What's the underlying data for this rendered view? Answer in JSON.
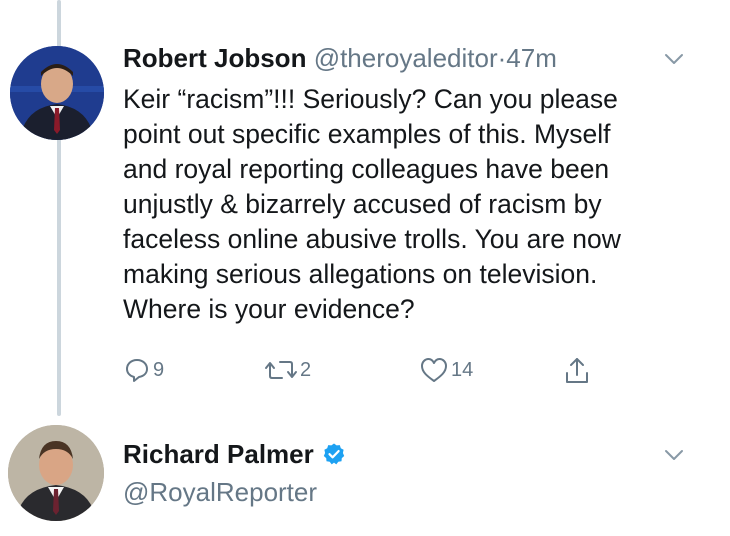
{
  "tweet1": {
    "name": "Robert Jobson",
    "handle": "@theroyaleditor",
    "separator": "·",
    "time": "47m",
    "text_lines": [
      "Keir “racism”!!! Seriously? Can you please",
      "point out specific examples of this. Myself",
      "and royal reporting colleagues have been",
      "unjustly & bizarrely accused of racism by",
      "faceless online abusive trolls. You are now",
      "making serious allegations on television.",
      "Where is your evidence?"
    ],
    "actions": {
      "reply_count": "9",
      "retweet_count": "2",
      "like_count": "14"
    },
    "icons": {
      "reply": "reply-icon",
      "retweet": "retweet-icon",
      "like": "heart-icon",
      "share": "share-icon",
      "more": "chevron-down-icon"
    }
  },
  "tweet2": {
    "name": "Richard Palmer",
    "handle": "@RoyalReporter",
    "verified": true,
    "icons": {
      "verified": "verified-badge-icon",
      "more": "chevron-down-icon"
    }
  },
  "colors": {
    "text": "#14171a",
    "secondary": "#657786",
    "verified": "#1da1f2",
    "thread_line": "#ccd6dd"
  }
}
